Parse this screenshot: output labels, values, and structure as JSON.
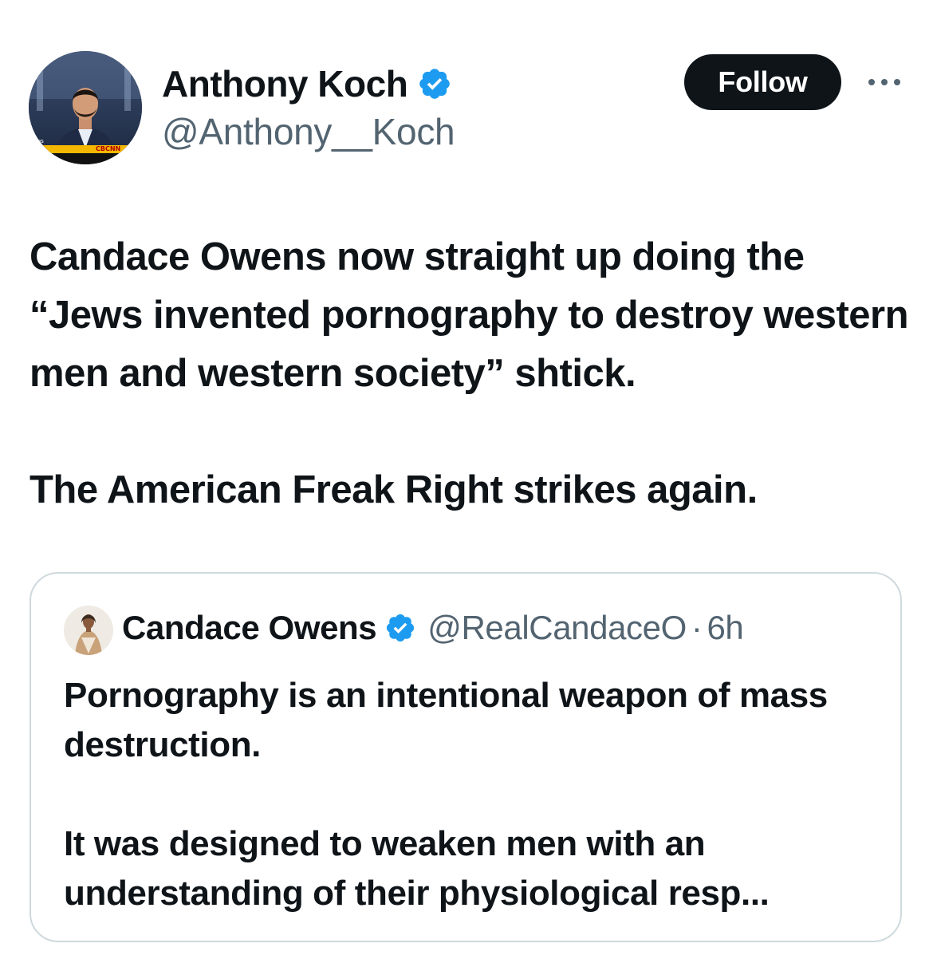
{
  "tweet": {
    "author": {
      "name": "Anthony Koch",
      "handle": "@Anthony__Koch",
      "verified": true,
      "avatar_caption": "CBCNN"
    },
    "follow_label": "Follow",
    "more_icon": "ellipsis-icon",
    "text": [
      "Candace Owens now straight up doing the “Jews invented pornography to destroy western men and western society” shtick.",
      "The American Freak Right strikes again."
    ]
  },
  "quote": {
    "author": {
      "name": "Candace Owens",
      "handle": "@RealCandaceO",
      "verified": true
    },
    "separator": "·",
    "time": "6h",
    "text": [
      "Pornography is an intentional weapon of mass destruction.",
      "It was designed to weaken men with an understanding of their physiological resp..."
    ]
  },
  "colors": {
    "text_primary": "#0f1419",
    "text_secondary": "#536471",
    "verified_blue": "#1d9bf0",
    "border": "#cfd9de",
    "follow_bg": "#0f1419"
  }
}
